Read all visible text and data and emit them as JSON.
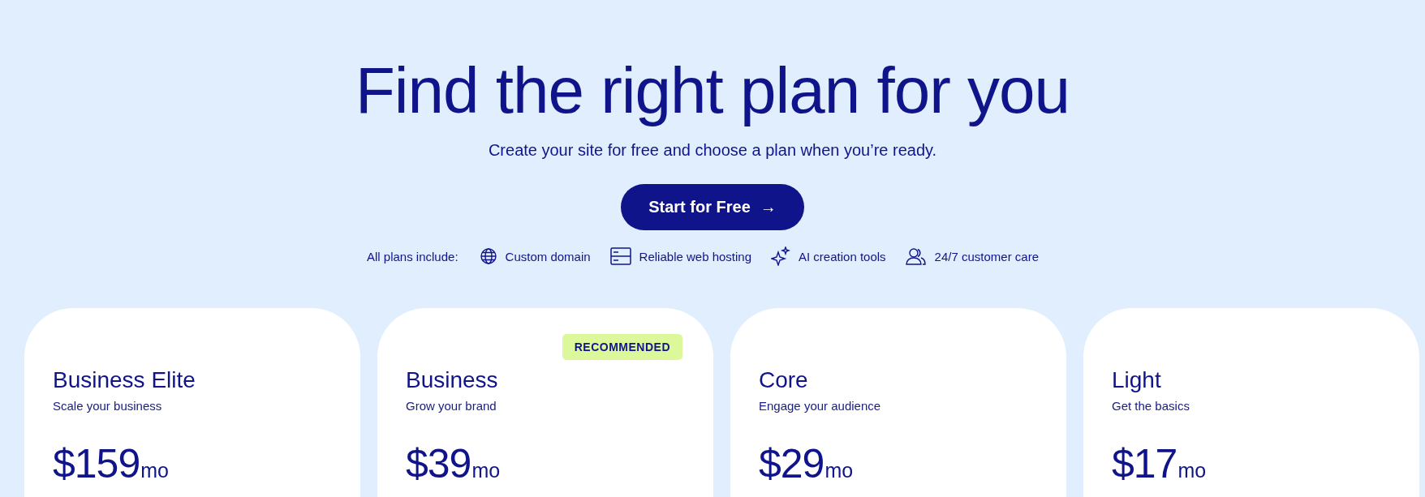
{
  "heading": "Find the right plan for you",
  "subheading": "Create your site for free and choose a plan when you’re ready.",
  "cta": {
    "label": "Start for Free",
    "arrow": "→"
  },
  "includes": {
    "label": "All plans include:",
    "items": [
      {
        "kind": "globe",
        "label": "Custom domain"
      },
      {
        "kind": "server",
        "label": "Reliable web hosting"
      },
      {
        "kind": "sparkle",
        "label": "AI creation tools"
      },
      {
        "kind": "people",
        "label": "24/7 customer care"
      }
    ]
  },
  "plans": [
    {
      "name": "Business Elite",
      "tagline": "Scale your business",
      "price": "$159",
      "period": "mo"
    },
    {
      "name": "Business",
      "tagline": "Grow your brand",
      "price": "$39",
      "period": "mo",
      "badge": "RECOMMENDED"
    },
    {
      "name": "Core",
      "tagline": "Engage your audience",
      "price": "$29",
      "period": "mo"
    },
    {
      "name": "Light",
      "tagline": "Get the basics",
      "price": "$17",
      "period": "mo"
    }
  ]
}
